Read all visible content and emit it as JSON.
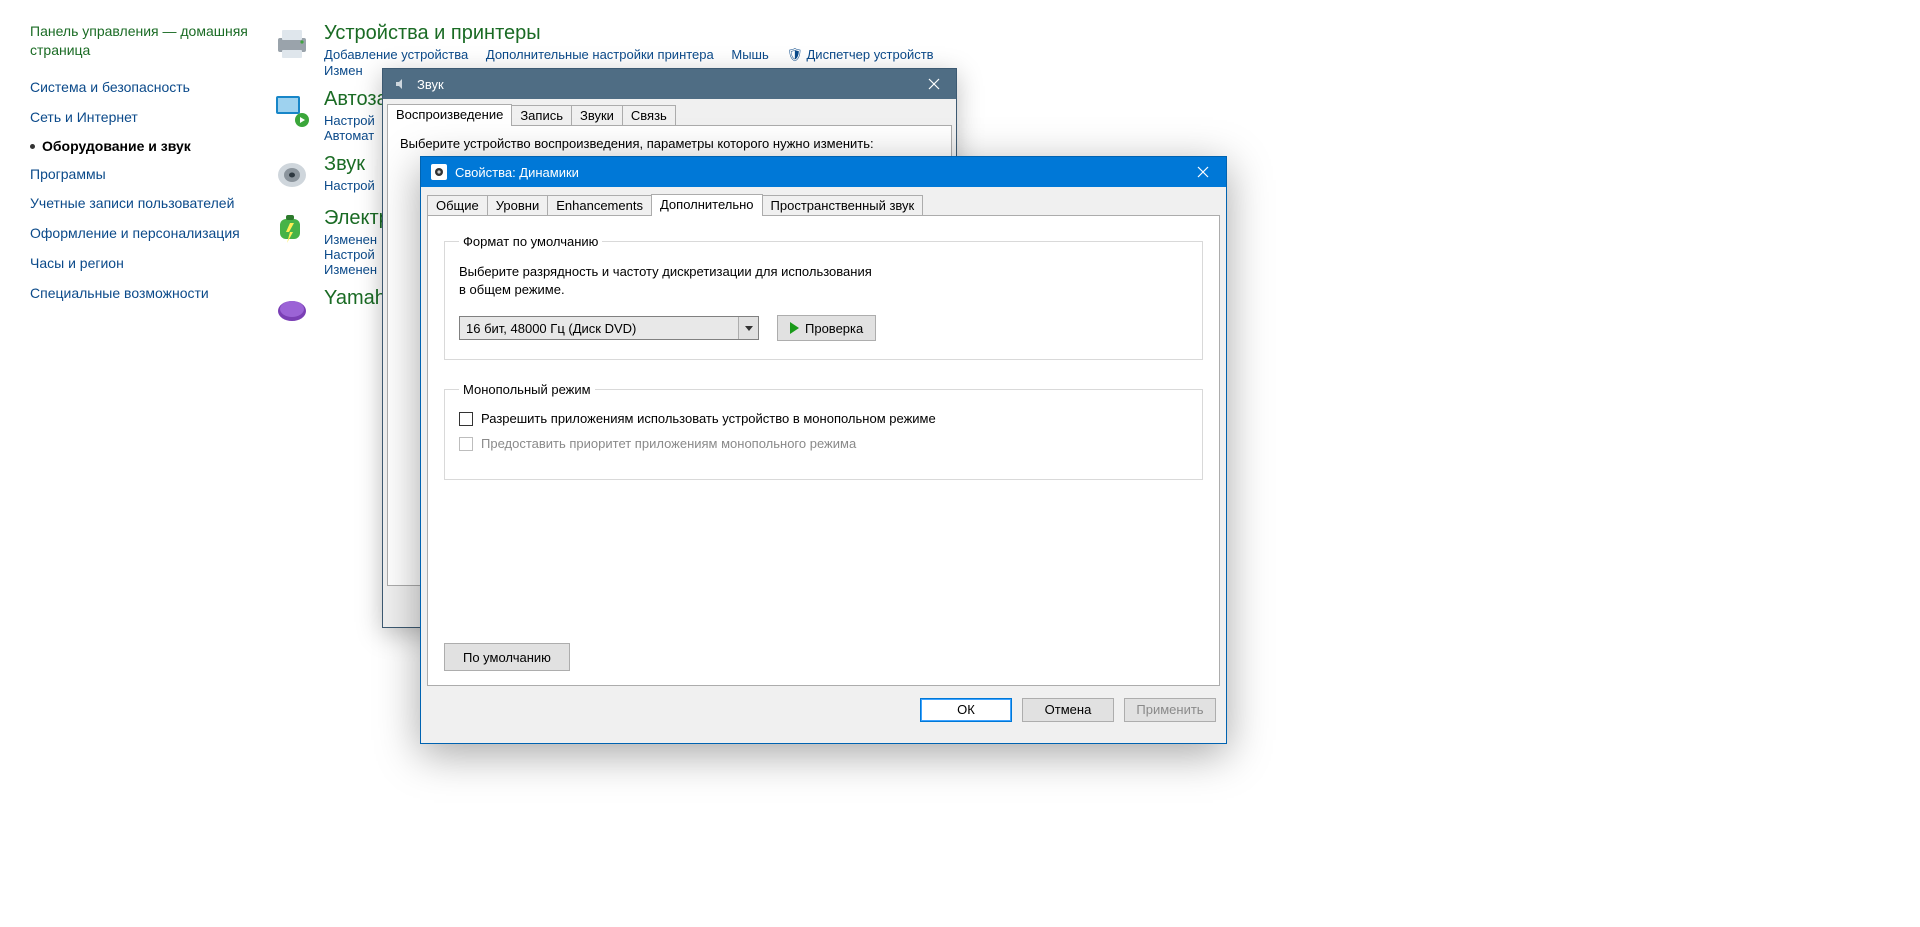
{
  "cp": {
    "home": "Панель управления — домашняя страница",
    "links": [
      "Система и безопасность",
      "Сеть и Интернет",
      "Оборудование и звук",
      "Программы",
      "Учетные записи пользователей",
      "Оформление и персонализация",
      "Часы и регион",
      "Специальные возможности"
    ],
    "active_index": 2,
    "categories": [
      {
        "title": "Устройства и принтеры",
        "links": [
          "Добавление устройства",
          "Дополнительные настройки принтера",
          "Мышь",
          "Диспетчер устройств"
        ],
        "line2": "Измен"
      },
      {
        "title": "Автоза",
        "links": [
          "Настрой",
          "Автомат"
        ],
        "line2": ""
      },
      {
        "title": "Звук",
        "links": [
          "Настрой"
        ],
        "line2": ""
      },
      {
        "title": "Электр",
        "links": [
          "Изменен",
          "Настрой",
          "Изменен"
        ],
        "line2": ""
      },
      {
        "title": "Yamah",
        "links": [],
        "line2": ""
      }
    ]
  },
  "sound": {
    "title": "Звук",
    "tabs": [
      "Воспроизведение",
      "Запись",
      "Звуки",
      "Связь"
    ],
    "active_tab_index": 0,
    "instruction": "Выберите устройство воспроизведения, параметры которого нужно изменить:"
  },
  "props": {
    "title": "Свойства: Динамики",
    "tabs": [
      "Общие",
      "Уровни",
      "Enhancements",
      "Дополнительно",
      "Пространственный звук"
    ],
    "active_tab_index": 3,
    "group_format": {
      "legend": "Формат по умолчанию",
      "desc_line1": "Выберите разрядность и частоту дискретизации для использования",
      "desc_line2": "в общем режиме.",
      "combo_value": "16 бит, 48000 Гц (Диск DVD)",
      "test_button": "Проверка"
    },
    "group_exclusive": {
      "legend": "Монопольный режим",
      "opt1": "Разрешить приложениям использовать устройство в монопольном режиме",
      "opt2": "Предоставить приоритет приложениям монопольного режима",
      "opt1_checked": false,
      "opt2_enabled": false
    },
    "defaults_button": "По умолчанию",
    "buttons": {
      "ok": "ОК",
      "cancel": "Отмена",
      "apply": "Применить"
    }
  }
}
